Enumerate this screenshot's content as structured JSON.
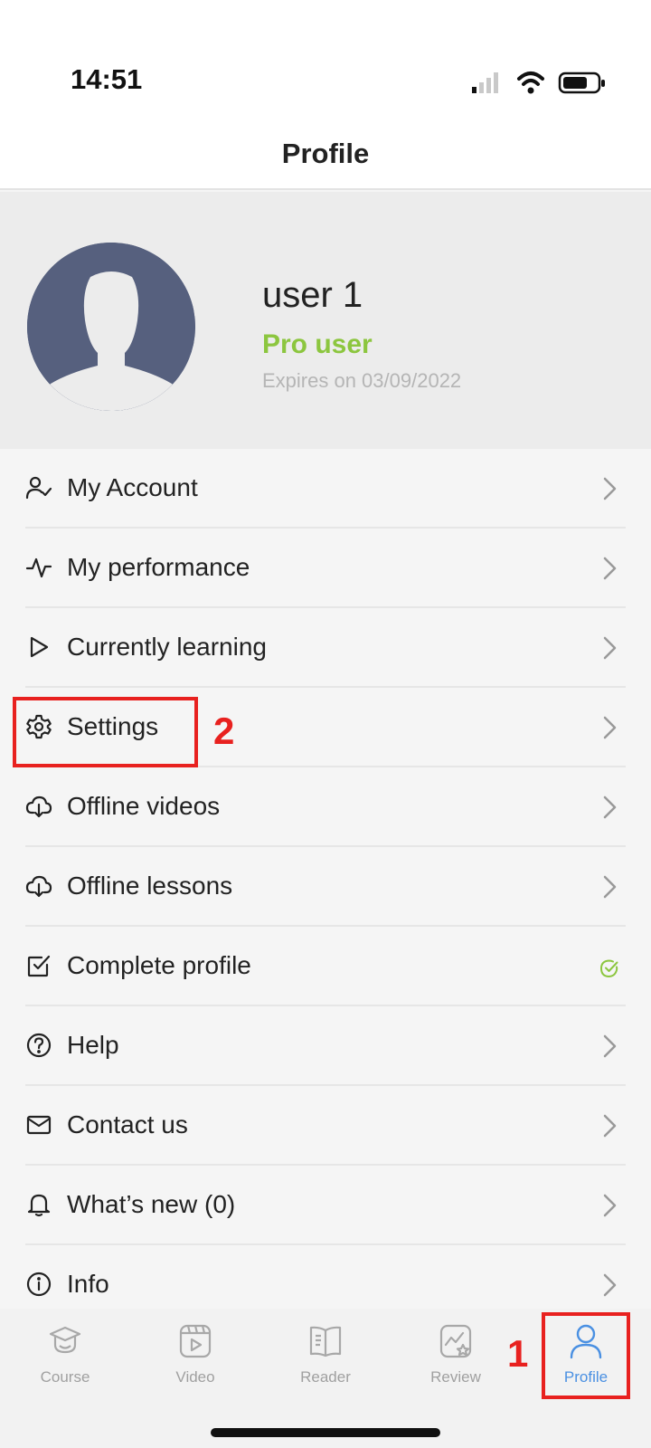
{
  "status_bar": {
    "time": "14:51",
    "icons": [
      "signal-icon",
      "wifi-icon",
      "battery-icon"
    ]
  },
  "header": {
    "title": "Profile"
  },
  "profile": {
    "name": "user 1",
    "plan": "Pro user",
    "expiry": "Expires on 03/09/2022",
    "avatar": "default-avatar-icon"
  },
  "menu": {
    "items": [
      {
        "label": "My Account",
        "icon": "account-icon",
        "accessory": "chevron"
      },
      {
        "label": "My performance",
        "icon": "pulse-icon",
        "accessory": "chevron"
      },
      {
        "label": "Currently learning",
        "icon": "play-icon",
        "accessory": "chevron"
      },
      {
        "label": "Settings",
        "icon": "gear-icon",
        "accessory": "chevron"
      },
      {
        "label": "Offline videos",
        "icon": "cloud-download-icon",
        "accessory": "chevron"
      },
      {
        "label": "Offline lessons",
        "icon": "cloud-download-icon",
        "accessory": "chevron"
      },
      {
        "label": "Complete profile",
        "icon": "checkbox-icon",
        "accessory": "check"
      },
      {
        "label": "Help",
        "icon": "help-icon",
        "accessory": "chevron"
      },
      {
        "label": "Contact us",
        "icon": "mail-icon",
        "accessory": "chevron"
      },
      {
        "label": "What’s new (0)",
        "icon": "bell-icon",
        "accessory": "chevron"
      },
      {
        "label": "Info",
        "icon": "info-icon",
        "accessory": "chevron"
      }
    ]
  },
  "tab_bar": {
    "tabs": [
      {
        "label": "Course",
        "icon": "graduation-cap-icon",
        "active": false
      },
      {
        "label": "Video",
        "icon": "video-icon",
        "active": false
      },
      {
        "label": "Reader",
        "icon": "book-icon",
        "active": false
      },
      {
        "label": "Review",
        "icon": "review-icon",
        "active": false
      },
      {
        "label": "Profile",
        "icon": "profile-icon",
        "active": true
      }
    ]
  },
  "annotations": {
    "step_1": "1",
    "step_2": "2"
  },
  "colors": {
    "accent_green": "#8cc63f",
    "active_tab": "#4a90e2",
    "annotation_red": "#e8211f",
    "avatar_bg": "#56607e"
  }
}
